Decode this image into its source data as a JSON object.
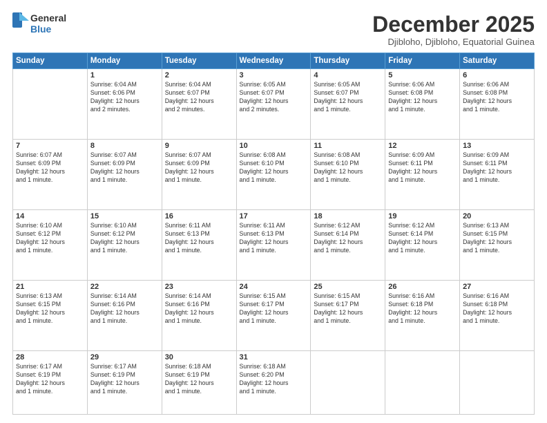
{
  "header": {
    "logo": {
      "line1": "General",
      "line2": "Blue"
    },
    "title": "December 2025",
    "location": "Djibloho, Djibloho, Equatorial Guinea"
  },
  "weekdays": [
    "Sunday",
    "Monday",
    "Tuesday",
    "Wednesday",
    "Thursday",
    "Friday",
    "Saturday"
  ],
  "weeks": [
    [
      {
        "day": "",
        "content": ""
      },
      {
        "day": "1",
        "content": "Sunrise: 6:04 AM\nSunset: 6:06 PM\nDaylight: 12 hours\nand 2 minutes."
      },
      {
        "day": "2",
        "content": "Sunrise: 6:04 AM\nSunset: 6:07 PM\nDaylight: 12 hours\nand 2 minutes."
      },
      {
        "day": "3",
        "content": "Sunrise: 6:05 AM\nSunset: 6:07 PM\nDaylight: 12 hours\nand 2 minutes."
      },
      {
        "day": "4",
        "content": "Sunrise: 6:05 AM\nSunset: 6:07 PM\nDaylight: 12 hours\nand 1 minute."
      },
      {
        "day": "5",
        "content": "Sunrise: 6:06 AM\nSunset: 6:08 PM\nDaylight: 12 hours\nand 1 minute."
      },
      {
        "day": "6",
        "content": "Sunrise: 6:06 AM\nSunset: 6:08 PM\nDaylight: 12 hours\nand 1 minute."
      }
    ],
    [
      {
        "day": "7",
        "content": "Sunrise: 6:07 AM\nSunset: 6:09 PM\nDaylight: 12 hours\nand 1 minute."
      },
      {
        "day": "8",
        "content": "Sunrise: 6:07 AM\nSunset: 6:09 PM\nDaylight: 12 hours\nand 1 minute."
      },
      {
        "day": "9",
        "content": "Sunrise: 6:07 AM\nSunset: 6:09 PM\nDaylight: 12 hours\nand 1 minute."
      },
      {
        "day": "10",
        "content": "Sunrise: 6:08 AM\nSunset: 6:10 PM\nDaylight: 12 hours\nand 1 minute."
      },
      {
        "day": "11",
        "content": "Sunrise: 6:08 AM\nSunset: 6:10 PM\nDaylight: 12 hours\nand 1 minute."
      },
      {
        "day": "12",
        "content": "Sunrise: 6:09 AM\nSunset: 6:11 PM\nDaylight: 12 hours\nand 1 minute."
      },
      {
        "day": "13",
        "content": "Sunrise: 6:09 AM\nSunset: 6:11 PM\nDaylight: 12 hours\nand 1 minute."
      }
    ],
    [
      {
        "day": "14",
        "content": "Sunrise: 6:10 AM\nSunset: 6:12 PM\nDaylight: 12 hours\nand 1 minute."
      },
      {
        "day": "15",
        "content": "Sunrise: 6:10 AM\nSunset: 6:12 PM\nDaylight: 12 hours\nand 1 minute."
      },
      {
        "day": "16",
        "content": "Sunrise: 6:11 AM\nSunset: 6:13 PM\nDaylight: 12 hours\nand 1 minute."
      },
      {
        "day": "17",
        "content": "Sunrise: 6:11 AM\nSunset: 6:13 PM\nDaylight: 12 hours\nand 1 minute."
      },
      {
        "day": "18",
        "content": "Sunrise: 6:12 AM\nSunset: 6:14 PM\nDaylight: 12 hours\nand 1 minute."
      },
      {
        "day": "19",
        "content": "Sunrise: 6:12 AM\nSunset: 6:14 PM\nDaylight: 12 hours\nand 1 minute."
      },
      {
        "day": "20",
        "content": "Sunrise: 6:13 AM\nSunset: 6:15 PM\nDaylight: 12 hours\nand 1 minute."
      }
    ],
    [
      {
        "day": "21",
        "content": "Sunrise: 6:13 AM\nSunset: 6:15 PM\nDaylight: 12 hours\nand 1 minute."
      },
      {
        "day": "22",
        "content": "Sunrise: 6:14 AM\nSunset: 6:16 PM\nDaylight: 12 hours\nand 1 minute."
      },
      {
        "day": "23",
        "content": "Sunrise: 6:14 AM\nSunset: 6:16 PM\nDaylight: 12 hours\nand 1 minute."
      },
      {
        "day": "24",
        "content": "Sunrise: 6:15 AM\nSunset: 6:17 PM\nDaylight: 12 hours\nand 1 minute."
      },
      {
        "day": "25",
        "content": "Sunrise: 6:15 AM\nSunset: 6:17 PM\nDaylight: 12 hours\nand 1 minute."
      },
      {
        "day": "26",
        "content": "Sunrise: 6:16 AM\nSunset: 6:18 PM\nDaylight: 12 hours\nand 1 minute."
      },
      {
        "day": "27",
        "content": "Sunrise: 6:16 AM\nSunset: 6:18 PM\nDaylight: 12 hours\nand 1 minute."
      }
    ],
    [
      {
        "day": "28",
        "content": "Sunrise: 6:17 AM\nSunset: 6:19 PM\nDaylight: 12 hours\nand 1 minute."
      },
      {
        "day": "29",
        "content": "Sunrise: 6:17 AM\nSunset: 6:19 PM\nDaylight: 12 hours\nand 1 minute."
      },
      {
        "day": "30",
        "content": "Sunrise: 6:18 AM\nSunset: 6:19 PM\nDaylight: 12 hours\nand 1 minute."
      },
      {
        "day": "31",
        "content": "Sunrise: 6:18 AM\nSunset: 6:20 PM\nDaylight: 12 hours\nand 1 minute."
      },
      {
        "day": "",
        "content": ""
      },
      {
        "day": "",
        "content": ""
      },
      {
        "day": "",
        "content": ""
      }
    ]
  ]
}
